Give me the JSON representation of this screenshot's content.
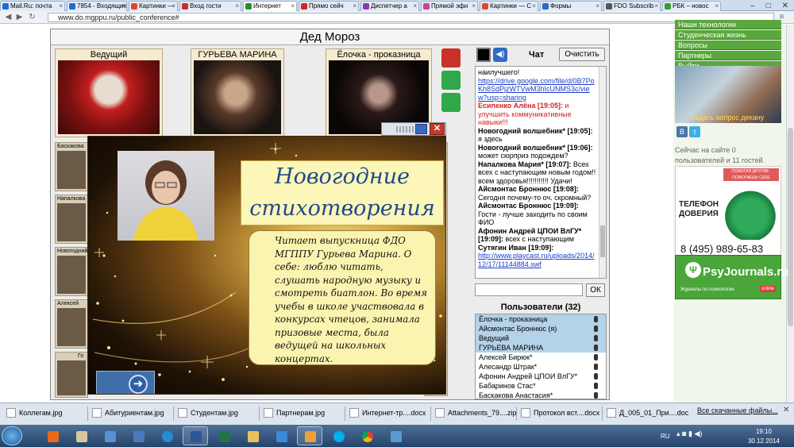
{
  "browser": {
    "tabs": [
      {
        "label": "Mail.Ru: почта",
        "color": "#1a6fd4"
      },
      {
        "label": "7854 - Входящие",
        "color": "#1a6fd4"
      },
      {
        "label": "Картинки — ",
        "color": "#e04a2a"
      },
      {
        "label": "Вход гости",
        "color": "#c03030"
      },
      {
        "label": "Интернет",
        "color": "#2a8a3a",
        "active": true
      },
      {
        "label": "Прямо сейч",
        "color": "#d02828"
      },
      {
        "label": "Диспетчер а",
        "color": "#8a3ab0"
      },
      {
        "label": "Прямой эфи",
        "color": "#d04090"
      },
      {
        "label": "Картинки — С",
        "color": "#e04a2a"
      },
      {
        "label": "Формы",
        "color": "#2a6ac8"
      },
      {
        "label": "FDO Subscrib",
        "color": "#555555"
      },
      {
        "label": "РБК – новос",
        "color": "#3a9a3a"
      }
    ],
    "url": "www.do.mgppu.ru/public_conference#"
  },
  "conference": {
    "title": "Дед Мороз",
    "cams": [
      "Ведущий",
      "ГУРЬЕВА МАРИНА",
      "Ёлочка - проказница"
    ],
    "thumbs": [
      "Баскакова А",
      "Напалкова",
      "Новогодний в",
      "Алексей",
      "Го"
    ],
    "right_partial": "с"
  },
  "chat": {
    "label": "Чат",
    "clear_button": "Очистить",
    "ok_button": "ОК",
    "messages": [
      {
        "t": "наилучшего!"
      },
      {
        "link": "https://drive.google.com/file/d/0B7PoKh8SdPjzWTVwM3hIcUNMS3c/view?usp=sharing"
      },
      {
        "name": "Есипенко Алёна [19:05]:",
        "text": "и улучшить коммуникативные навыки!!!",
        "red": true
      },
      {
        "name": "Новогодний волшебник* [19:05]:",
        "text": "я здесь"
      },
      {
        "name": "Новогодний волшебник* [19:06]:",
        "text": "может сюрприз подождем?"
      },
      {
        "name": "Напалкова Мария* [19:07]:",
        "text": "Всех всех с наступающим новым годом!! всем здоровья!!!!!!!!!!! Удачи!"
      },
      {
        "name": "Айсмонтас Броннюс [19:08]:",
        "text": "Сегодня почему-то оч. скромный?"
      },
      {
        "name": "Айсмонтас Броннюс [19:09]:",
        "text": "Гости - лучше заходить по своим ФИО"
      },
      {
        "name": "Афонин Андрей ЦПОИ ВлГУ* [19:09]:",
        "text": "всех с наступающим"
      },
      {
        "name": "Сутягин Иван [19:09]:",
        "text": ""
      },
      {
        "link": "http://www.playcast.ru/uploads/2014/12/17/11144884.swf"
      }
    ],
    "users_header": "Пользователи (32)",
    "users": [
      {
        "name": "Ёлочка - проказница",
        "sel": true
      },
      {
        "name": "Айсмонтас Броннюс (я)",
        "sel": true
      },
      {
        "name": "Ведущий",
        "sel": true
      },
      {
        "name": "ГУРЬЕВА МАРИНА",
        "sel": true
      },
      {
        "name": "Алексей Бирюк*"
      },
      {
        "name": "Алесандр Штрак*"
      },
      {
        "name": "Афонин Андрей ЦПОИ ВлГУ*"
      },
      {
        "name": "Бабаринов Стас*"
      },
      {
        "name": "Баскакова Анастасия*"
      }
    ]
  },
  "overlay": {
    "title_line1": "Новогодние",
    "title_line2": "стихотворения",
    "text": "Читает выпускница ФДО МГППУ Гурьева Марина. О себе: люблю читать, слушать народную музыку и смотреть биатлон. Во время учебы в школе участвовала в конкурсах чтецов, занимала призовые места, была ведущей на школьных концертах.",
    "next_icon": "arrow-right-icon"
  },
  "site": {
    "menu": [
      "Наши технологии",
      "Студенческая жизнь",
      "Вопросы",
      "Партнеры",
      "Выйти"
    ],
    "news_caption": "Задать вопрос декану",
    "social": [
      "В",
      "t"
    ],
    "online_line1": "Сейчас на сайте 0",
    "online_line2": "пользователей и 11 гостей.",
    "trust_top": "ПОМОГАЯ ДРУГИМ - ПОМОГАЕШЬ СЕБЕ",
    "trust_label1": "ТЕЛЕФОН",
    "trust_label2": "ДОВЕРИЯ",
    "trust_phone": "8 (495) 989-65-83",
    "psy_logo": "PsyJournals.ru",
    "psy_sub": "Журналы по психологии",
    "psy_online": "online"
  },
  "downloads": {
    "items": [
      "Коллегам.jpg",
      "Абитуриентам.jpg",
      "Студентам.jpg",
      "Партнерам.jpg",
      "Интернет-тр....docx",
      "Attachments_79....zip",
      "Протокол вст....docx",
      "Д_005_01_При....doc"
    ],
    "all_label": "Все скачанные файлы..."
  },
  "taskbar": {
    "lang": "RU",
    "time": "19:10",
    "date": "30.12.2014"
  }
}
